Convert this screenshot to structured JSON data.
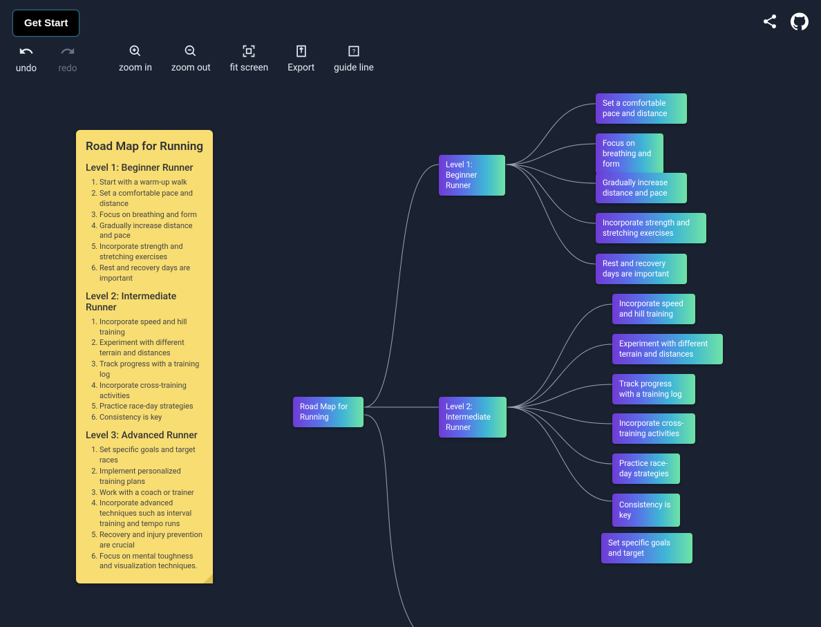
{
  "header": {
    "get_start": "Get Start"
  },
  "toolbar": {
    "undo": "undo",
    "redo": "redo",
    "zoom_in": "zoom in",
    "zoom_out": "zoom out",
    "fit_screen": "fit screen",
    "export": "Export",
    "guide_line": "guide line"
  },
  "panel": {
    "title": "Road Map for Running",
    "level1": {
      "heading": "Level 1: Beginner Runner",
      "items": [
        "Start with a warm-up walk",
        "Set a comfortable pace and distance",
        "Focus on breathing and form",
        "Gradually increase distance and pace",
        "Incorporate strength and stretching exercises",
        "Rest and recovery days are important"
      ]
    },
    "level2": {
      "heading": "Level 2: Intermediate Runner",
      "items": [
        "Incorporate speed and hill training",
        "Experiment with different terrain and distances",
        "Track progress with a training log",
        "Incorporate cross-training activities",
        "Practice race-day strategies",
        "Consistency is key"
      ]
    },
    "level3": {
      "heading": "Level 3: Advanced Runner",
      "items": [
        "Set specific goals and target races",
        "Implement personalized training plans",
        "Work with a coach or trainer",
        "Incorporate advanced techniques such as interval training and tempo runs",
        "Recovery and injury prevention are crucial",
        "Focus on mental toughness and visualization techniques."
      ]
    }
  },
  "mindmap": {
    "root": "Road Map for Running",
    "level1": {
      "label": "Level 1: Beginner Runner",
      "leaves": [
        "Set a comfortable pace and distance",
        "Focus on breathing and form",
        "Gradually increase distance and pace",
        "Incorporate strength and stretching exercises",
        "Rest and recovery days are important"
      ]
    },
    "level2": {
      "label": "Level 2: Intermediate Runner",
      "leaves": [
        "Incorporate speed and hill training",
        "Experiment with different terrain and distances",
        "Track progress with a training log",
        "Incorporate cross-training activities",
        "Practice race-day strategies",
        "Consistency is key"
      ]
    },
    "level3_partial": {
      "leaves": [
        "Set specific goals and target"
      ]
    }
  }
}
